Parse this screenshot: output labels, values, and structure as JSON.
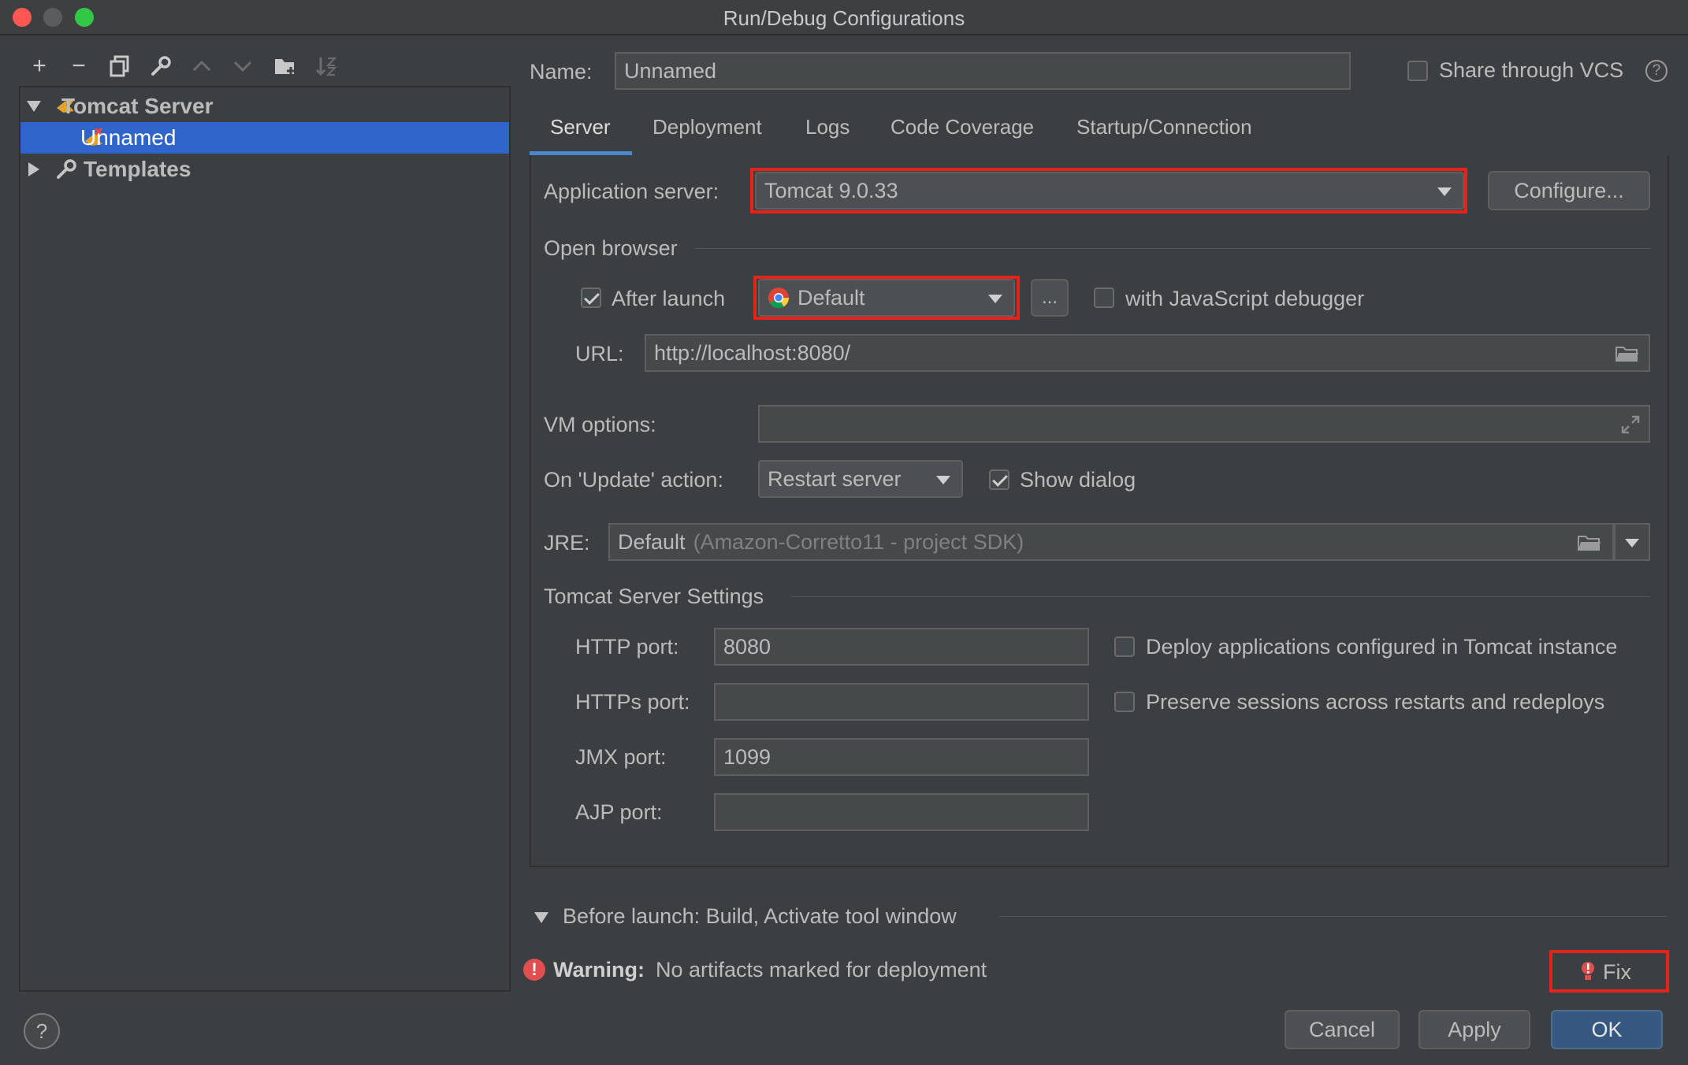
{
  "window": {
    "title": "Run/Debug Configurations"
  },
  "toolbar": {
    "add": "+",
    "remove": "−"
  },
  "tree": {
    "items": [
      {
        "label": "Tomcat Server"
      },
      {
        "label": "Unnamed"
      },
      {
        "label": "Templates"
      }
    ]
  },
  "form": {
    "name_label": "Name:",
    "name_value": "Unnamed",
    "share_label": "Share through VCS",
    "help_glyph": "?"
  },
  "tabs": [
    {
      "label": "Server"
    },
    {
      "label": "Deployment"
    },
    {
      "label": "Logs"
    },
    {
      "label": "Code Coverage"
    },
    {
      "label": "Startup/Connection"
    }
  ],
  "server": {
    "app_server_label": "Application server:",
    "app_server_value": "Tomcat 9.0.33",
    "configure_label": "Configure...",
    "open_browser_label": "Open browser",
    "after_launch_label": "After launch",
    "browser_value": "Default",
    "ellipsis_label": "...",
    "js_debugger_label": "with JavaScript debugger",
    "url_label": "URL:",
    "url_value": "http://localhost:8080/",
    "vm_options_label": "VM options:",
    "vm_options_value": "",
    "update_action_label": "On 'Update' action:",
    "update_action_value": "Restart server",
    "show_dialog_label": "Show dialog",
    "jre_label": "JRE:",
    "jre_value": "Default",
    "jre_hint": "(Amazon-Corretto11 - project SDK)",
    "tomcat_settings_label": "Tomcat Server Settings",
    "http_port_label": "HTTP port:",
    "http_port_value": "8080",
    "https_port_label": "HTTPs port:",
    "https_port_value": "",
    "jmx_port_label": "JMX port:",
    "jmx_port_value": "1099",
    "ajp_port_label": "AJP port:",
    "ajp_port_value": "",
    "deploy_apps_label": "Deploy applications configured in Tomcat instance",
    "preserve_sessions_label": "Preserve sessions across restarts and redeploys"
  },
  "before_launch": {
    "label": "Before launch: Build, Activate tool window"
  },
  "warning": {
    "title": "Warning:",
    "message": "No artifacts marked for deployment",
    "fix_label": "Fix"
  },
  "footer": {
    "cancel_label": "Cancel",
    "apply_label": "Apply",
    "ok_label": "OK",
    "help_glyph": "?"
  },
  "colors": {
    "background": "#3c3f41",
    "selection": "#2f65ca",
    "highlight_box": "#e5231b",
    "primary_button": "#365880"
  }
}
